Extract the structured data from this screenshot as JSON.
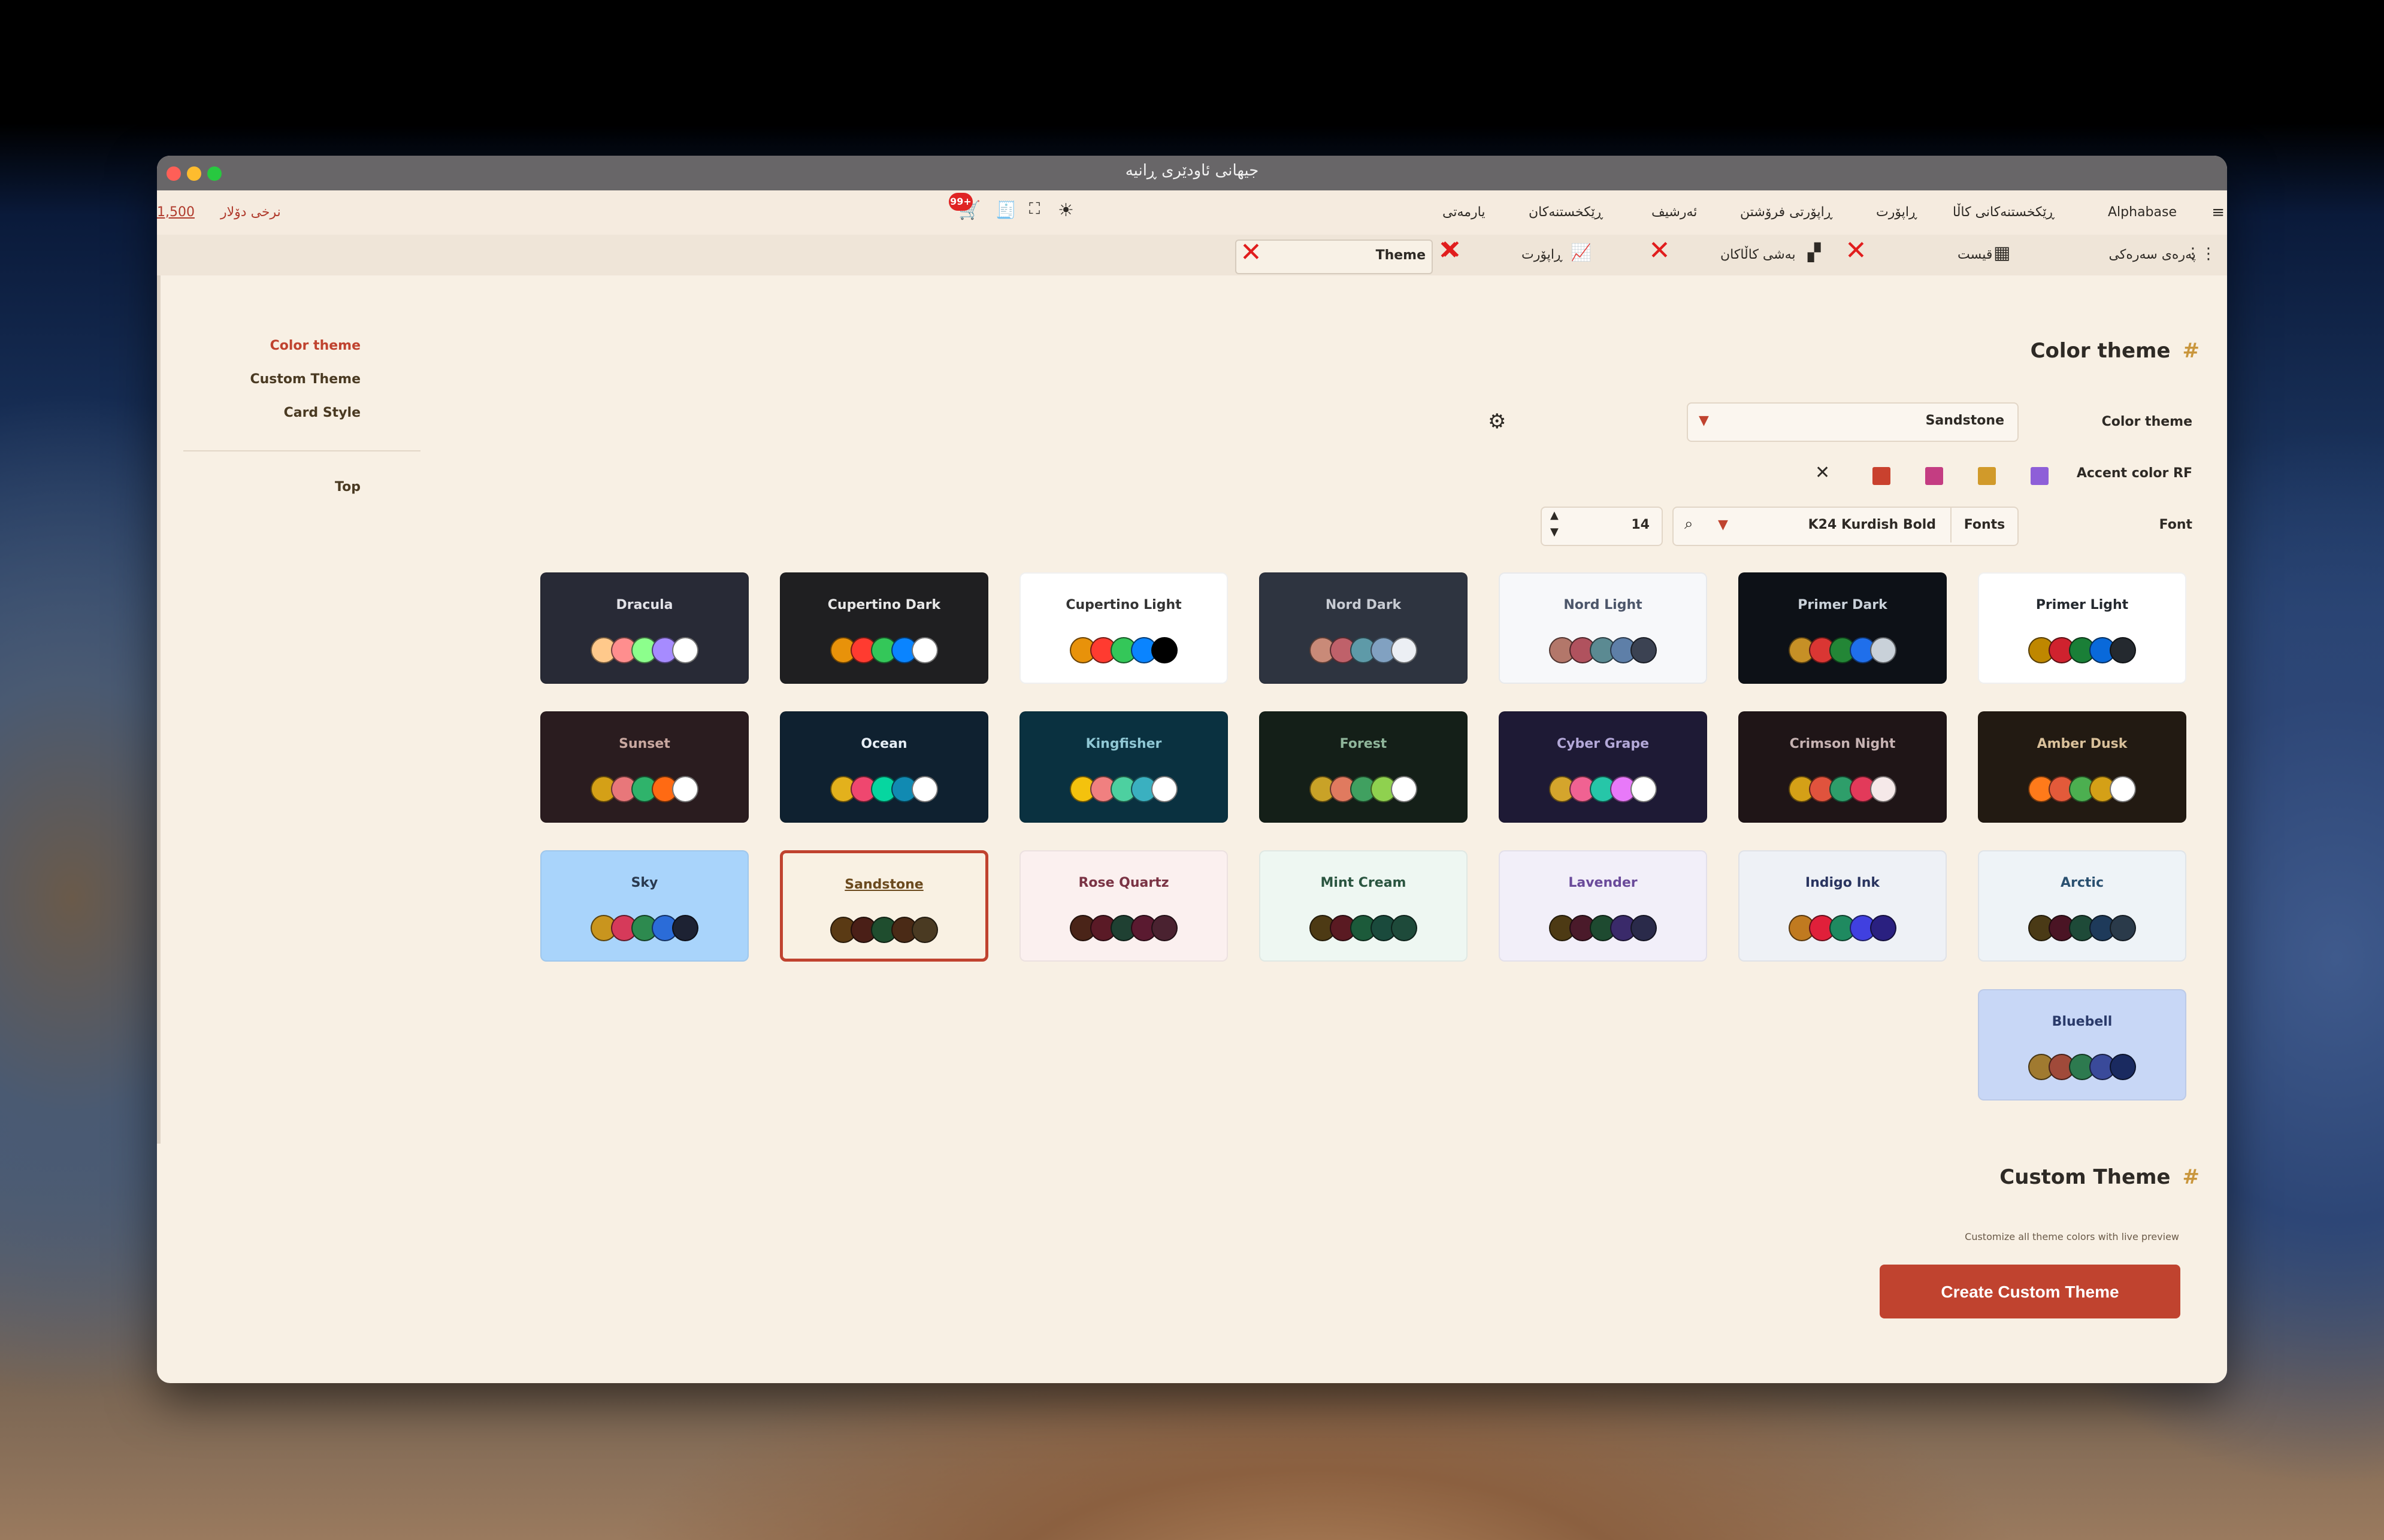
{
  "window": {
    "title": "جیهانی ئاودێری ڕانیە"
  },
  "menu": {
    "items": [
      "Alphabase",
      "ڕێکخستنەکانی کاڵا",
      "ڕاپۆرت",
      "ڕاپۆرتی فرۆشتن",
      "ئەرشیف",
      "ڕێکخستنەکان",
      "یارمەتی"
    ],
    "rate_label": "نرخی دۆلار",
    "rate_value": "1,500",
    "notification_badge": "99+"
  },
  "tabs": {
    "items": [
      {
        "label": "پەرەی سەرەکی",
        "icon": "grid-icon"
      },
      {
        "label": "قیست",
        "icon": "calendar-icon"
      },
      {
        "label": "بەشی کاڵاکان",
        "icon": "boxes-icon"
      },
      {
        "label": "ڕاپۆرت",
        "icon": "chart-icon"
      },
      {
        "label": "Theme",
        "icon": ""
      }
    ]
  },
  "sidebar": {
    "items": [
      {
        "label": "Color theme",
        "active": true
      },
      {
        "label": "Custom Theme",
        "active": false
      },
      {
        "label": "Card Style",
        "active": false
      },
      {
        "label": "Top",
        "active": false
      }
    ]
  },
  "section_color_theme": {
    "title": "Color theme",
    "color_theme_label": "Color theme",
    "color_theme_value": "Sandstone",
    "accent_label": "Accent color RF",
    "accent_colors": [
      "#8e5fd8",
      "#d19a2a",
      "#c43d82",
      "#c9412e"
    ],
    "font_label": "Font",
    "fonts_button": "Fonts",
    "font_value": "K24 Kurdish Bold",
    "font_size": "14"
  },
  "themes": [
    {
      "name": "Dracula",
      "bg": "#282a36",
      "fg": "#e2e2e8",
      "colors": [
        "#ffc98b",
        "#ff8e8e",
        "#8cff8c",
        "#a68bff",
        "#ffffff"
      ]
    },
    {
      "name": "Cupertino Dark",
      "bg": "#1f1f21",
      "fg": "#e8e8e8",
      "colors": [
        "#e8920a",
        "#ff3b30",
        "#34c759",
        "#0a84ff",
        "#ffffff"
      ]
    },
    {
      "name": "Cupertino Light",
      "bg": "#ffffff",
      "fg": "#333333",
      "colors": [
        "#e8920a",
        "#ff3b30",
        "#34c759",
        "#0a84ff",
        "#000000"
      ]
    },
    {
      "name": "Nord Dark",
      "bg": "#2e3440",
      "fg": "#c8ccd4",
      "colors": [
        "#c98a78",
        "#bf616a",
        "#5e9aa8",
        "#81a1c1",
        "#eceff4"
      ]
    },
    {
      "name": "Nord Light",
      "bg": "#f7f8fa",
      "fg": "#4c566a",
      "colors": [
        "#b3776a",
        "#b0525e",
        "#5b8a92",
        "#5e7fa8",
        "#3b4252"
      ]
    },
    {
      "name": "Primer Dark",
      "bg": "#0d1117",
      "fg": "#c9d1d9",
      "colors": [
        "#c69026",
        "#da3633",
        "#238636",
        "#1f6feb",
        "#c9d1d9"
      ]
    },
    {
      "name": "Primer Light",
      "bg": "#ffffff",
      "fg": "#24292f",
      "colors": [
        "#bf8700",
        "#cf222e",
        "#1a7f37",
        "#0969da",
        "#24292f"
      ]
    },
    {
      "name": "Sunset",
      "bg": "#2a1c1f",
      "fg": "#c9a8a0",
      "colors": [
        "#d4a017",
        "#e8777a",
        "#2fb36b",
        "#ff6a13",
        "#ffffff"
      ]
    },
    {
      "name": "Ocean",
      "bg": "#0f2130",
      "fg": "#e6eef5",
      "colors": [
        "#e3b11c",
        "#ef476f",
        "#06d6a0",
        "#118ab2",
        "#ffffff"
      ]
    },
    {
      "name": "Kingfisher",
      "bg": "#0a3140",
      "fg": "#8fc7d4",
      "colors": [
        "#f4c20d",
        "#f08080",
        "#4dd0a0",
        "#3ab0c0",
        "#ffffff"
      ]
    },
    {
      "name": "Forest",
      "bg": "#141f18",
      "fg": "#8fb59a",
      "colors": [
        "#c9a227",
        "#e07a5f",
        "#40a060",
        "#8fd14f",
        "#ffffff"
      ]
    },
    {
      "name": "Cyber Grape",
      "bg": "#1e1a35",
      "fg": "#b3a8d8",
      "colors": [
        "#d4a52c",
        "#f06292",
        "#26c6a8",
        "#e879f9",
        "#ffffff"
      ]
    },
    {
      "name": "Crimson Night",
      "bg": "#1f1517",
      "fg": "#c6b2b2",
      "colors": [
        "#d4a017",
        "#e0533d",
        "#2e9e6a",
        "#e23a5a",
        "#f5e9e9"
      ]
    },
    {
      "name": "Amber Dusk",
      "bg": "#221a12",
      "fg": "#d9c09a",
      "colors": [
        "#ff7a1a",
        "#e35a3a",
        "#4caf50",
        "#d4a017",
        "#ffffff"
      ]
    },
    {
      "name": "Sky",
      "bg": "#a9d4fb",
      "fg": "#2a3a50",
      "colors": [
        "#c9951e",
        "#d63a5a",
        "#2d8a4f",
        "#2b6cd8",
        "#1d2233"
      ]
    },
    {
      "name": "Sandstone",
      "bg": "#f9f1e3",
      "fg": "#6b4a1e",
      "colors": [
        "#5a3a14",
        "#4a1f17",
        "#1f4d2e",
        "#4a2a16",
        "#4a3a22"
      ]
    },
    {
      "name": "Rose Quartz",
      "bg": "#fbf0ef",
      "fg": "#7a3344",
      "colors": [
        "#4a2418",
        "#5a1a26",
        "#1f4032",
        "#5a1a30",
        "#4a2230"
      ]
    },
    {
      "name": "Mint Cream",
      "bg": "#eef7f2",
      "fg": "#2a5540",
      "colors": [
        "#4d3a14",
        "#5a1a22",
        "#1c5a3a",
        "#1a4a3c",
        "#1e4a3a"
      ]
    },
    {
      "name": "Lavender",
      "bg": "#f2eff9",
      "fg": "#6a4a9a",
      "colors": [
        "#4d3a14",
        "#4a1a2a",
        "#1e4a30",
        "#3a2a6a",
        "#2a2a4a"
      ]
    },
    {
      "name": "Indigo Ink",
      "bg": "#eef1f6",
      "fg": "#2a3560",
      "colors": [
        "#c07a20",
        "#e0203a",
        "#1f8a60",
        "#4040e0",
        "#2a2080"
      ]
    },
    {
      "name": "Arctic",
      "bg": "#eef3f7",
      "fg": "#2a5070",
      "colors": [
        "#4a3a16",
        "#4a1424",
        "#1e4a38",
        "#1e3a5a",
        "#2a3a4a"
      ]
    },
    {
      "name": "Bluebell",
      "bg": "#c8d7f6",
      "fg": "#2a3a6a",
      "colors": [
        "#a07a30",
        "#a04a3a",
        "#2d7a4f",
        "#3a4a9a",
        "#1a2a60"
      ]
    }
  ],
  "selected_theme": "Sandstone",
  "section_custom": {
    "title": "Custom Theme",
    "subtitle": "Customize all theme colors with live preview",
    "button": "Create Custom Theme"
  }
}
